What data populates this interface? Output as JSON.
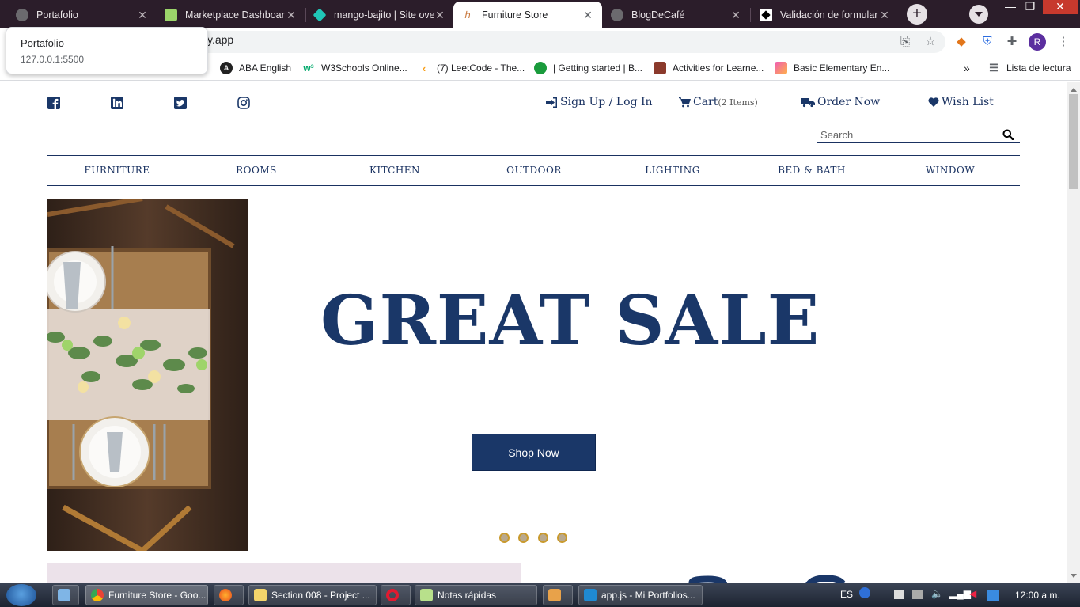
{
  "browser": {
    "tabs": [
      {
        "title": "Portafolio",
        "active": false
      },
      {
        "title": "Marketplace Dashboard",
        "active": false
      },
      {
        "title": "mango-bajito | Site ove",
        "active": false
      },
      {
        "title": "Furniture Store",
        "active": true
      },
      {
        "title": "BlogDeCafé",
        "active": false
      },
      {
        "title": "Validación de formulari",
        "active": false
      }
    ],
    "new_tab": "+",
    "window_controls": {
      "minimize": "—",
      "restore": "❐",
      "close": "✕"
    },
    "url": "y.app",
    "tooltip": {
      "title": "Portafolio",
      "url": "127.0.0.1:5500"
    },
    "profile_initial": "R",
    "bookmarks": [
      {
        "label": "ABA English"
      },
      {
        "label": "W3Schools Online..."
      },
      {
        "label": "(7) LeetCode - The..."
      },
      {
        "label": "| Getting started | B..."
      },
      {
        "label": "Activities for Learne..."
      },
      {
        "label": "Basic Elementary En..."
      }
    ],
    "bookmarks_more": "»",
    "reading_list": "Lista de lectura"
  },
  "site": {
    "social": [
      "facebook-icon",
      "linkedin-icon",
      "twitter-icon",
      "instagram-icon"
    ],
    "top_links": {
      "signup": "Sign Up / Log In",
      "cart": "Cart",
      "cart_count": "(2 Items)",
      "order": "Order Now",
      "wishlist": "Wish List"
    },
    "search_placeholder": "Search",
    "nav": [
      "FURNITURE",
      "ROOMS",
      "KITCHEN",
      "OUTDOOR",
      "LIGHTING",
      "BED & BATH",
      "WINDOW"
    ],
    "hero": {
      "title": "GREAT SALE",
      "cta": "Shop Now",
      "slides": 4,
      "active_slide": 0
    },
    "colors": {
      "brand": "#1a3768",
      "dot_border": "#c99a2e"
    }
  },
  "taskbar": {
    "items": [
      {
        "label": "Furniture Store - Goo..."
      },
      {
        "label": "Section 008 - Project ..."
      },
      {
        "label": "Notas rápidas"
      },
      {
        "label": "app.js - Mi Portfolios..."
      }
    ],
    "lang": "ES",
    "clock": "12:00 a.m."
  }
}
